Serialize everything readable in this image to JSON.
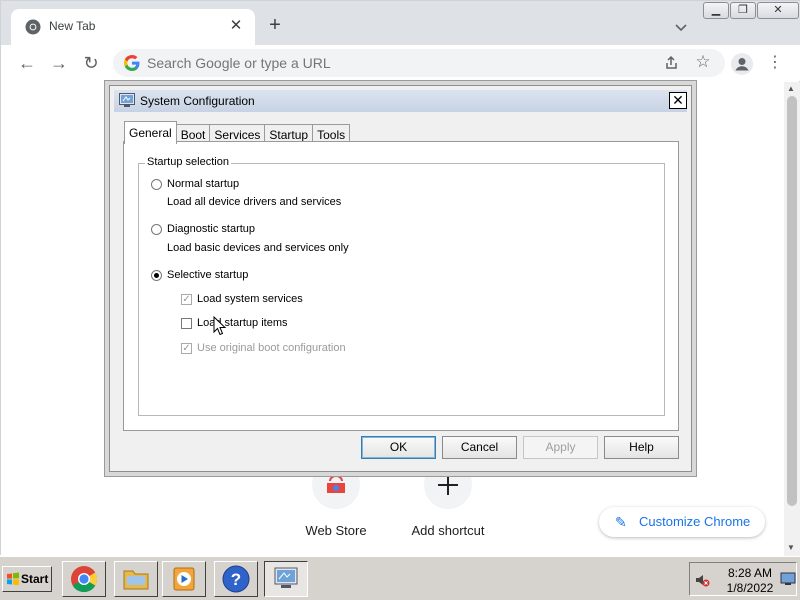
{
  "browser": {
    "tab_title": "New Tab",
    "omnibox_placeholder": "Search Google or type a URL",
    "shortcuts": [
      {
        "label": "Web Store"
      },
      {
        "label": "Add shortcut"
      }
    ],
    "customize_label": "Customize Chrome",
    "icons": [
      "chrome-favicon",
      "tab-close-icon",
      "new-tab-icon",
      "tab-search-icon",
      "back-icon",
      "forward-icon",
      "reload-icon",
      "google-g-icon",
      "share-icon",
      "bookmark-star-icon",
      "profile-icon",
      "menu-icon",
      "pencil-icon"
    ]
  },
  "dialog": {
    "title": "System Configuration",
    "tabs": [
      {
        "label": "General",
        "active": true
      },
      {
        "label": "Boot",
        "active": false
      },
      {
        "label": "Services",
        "active": false
      },
      {
        "label": "Startup",
        "active": false
      },
      {
        "label": "Tools",
        "active": false
      }
    ],
    "group_label": "Startup selection",
    "radios": [
      {
        "label": "Normal startup",
        "description": "Load all device drivers and services",
        "selected": false
      },
      {
        "label": "Diagnostic startup",
        "description": "Load basic devices and services only",
        "selected": false
      },
      {
        "label": "Selective startup",
        "selected": true
      }
    ],
    "checkboxes": [
      {
        "label": "Load system services",
        "checked": true,
        "enabled": false
      },
      {
        "label": "Load startup items",
        "checked": false,
        "enabled": true
      },
      {
        "label": "Use original boot configuration",
        "checked": true,
        "enabled": false
      }
    ],
    "buttons": {
      "ok": "OK",
      "cancel": "Cancel",
      "apply": "Apply",
      "help": "Help"
    }
  },
  "taskbar": {
    "start_label": "Start",
    "apps": [
      "chrome-icon",
      "explorer-icon",
      "media-player-icon",
      "help-icon",
      "msconfig-icon"
    ],
    "clock_time": "8:28 AM",
    "clock_date": "1/8/2022"
  }
}
